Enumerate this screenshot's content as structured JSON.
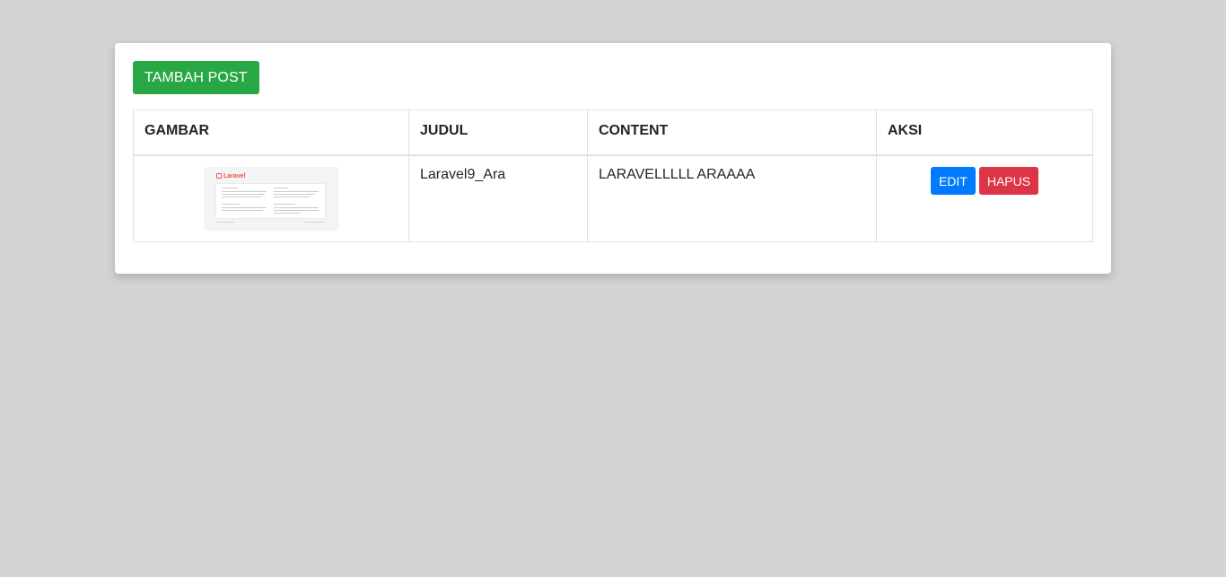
{
  "toolbar": {
    "add_label": "TAMBAH POST",
    "add_color": "#28a745"
  },
  "table": {
    "headers": [
      "GAMBAR",
      "JUDUL",
      "CONTENT",
      "AKSI"
    ],
    "rows": [
      {
        "image_logo_text": "Laravel",
        "judul": "Laravel9_Ara",
        "content": "LARAVELLLLL ARAAAA",
        "edit_label": "EDIT",
        "hapus_label": "HAPUS"
      }
    ]
  },
  "colors": {
    "edit": "#007bff",
    "hapus": "#dc3545",
    "background": "#d3d3d3"
  }
}
